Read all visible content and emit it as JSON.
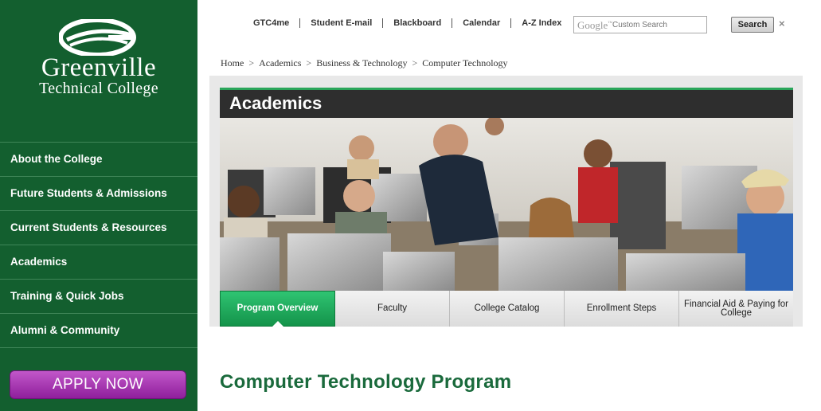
{
  "logo": {
    "name": "Greenville",
    "subtitle": "Technical College"
  },
  "sidebar": {
    "items": [
      {
        "label": "About the College"
      },
      {
        "label": "Future Students & Admissions"
      },
      {
        "label": "Current Students & Resources"
      },
      {
        "label": "Academics"
      },
      {
        "label": "Training & Quick Jobs"
      },
      {
        "label": "Alumni & Community"
      }
    ],
    "apply_label": "APPLY NOW"
  },
  "topbar": {
    "links": [
      {
        "label": "GTC4me"
      },
      {
        "label": "Student E-mail"
      },
      {
        "label": "Blackboard"
      },
      {
        "label": "Calendar"
      },
      {
        "label": "A-Z Index"
      }
    ]
  },
  "search": {
    "brand": "Google",
    "placeholder": "Custom Search",
    "button_label": "Search",
    "close_glyph": "×"
  },
  "breadcrumb": {
    "items": [
      {
        "label": "Home"
      },
      {
        "label": "Academics"
      },
      {
        "label": "Business & Technology"
      },
      {
        "label": "Computer Technology"
      }
    ],
    "separator": ">"
  },
  "section": {
    "title": "Academics"
  },
  "tabs": [
    {
      "label": "Program Overview",
      "active": true
    },
    {
      "label": "Faculty"
    },
    {
      "label": "College Catalog"
    },
    {
      "label": "Enrollment Steps"
    },
    {
      "label": "Financial Aid & Paying for College"
    }
  ],
  "main": {
    "heading": "Computer Technology Program"
  },
  "colors": {
    "sidebar_green": "#135f2f",
    "accent_green": "#2aa55a",
    "heading_green": "#1a6a3c",
    "apply_purple": "#a63ab3"
  }
}
